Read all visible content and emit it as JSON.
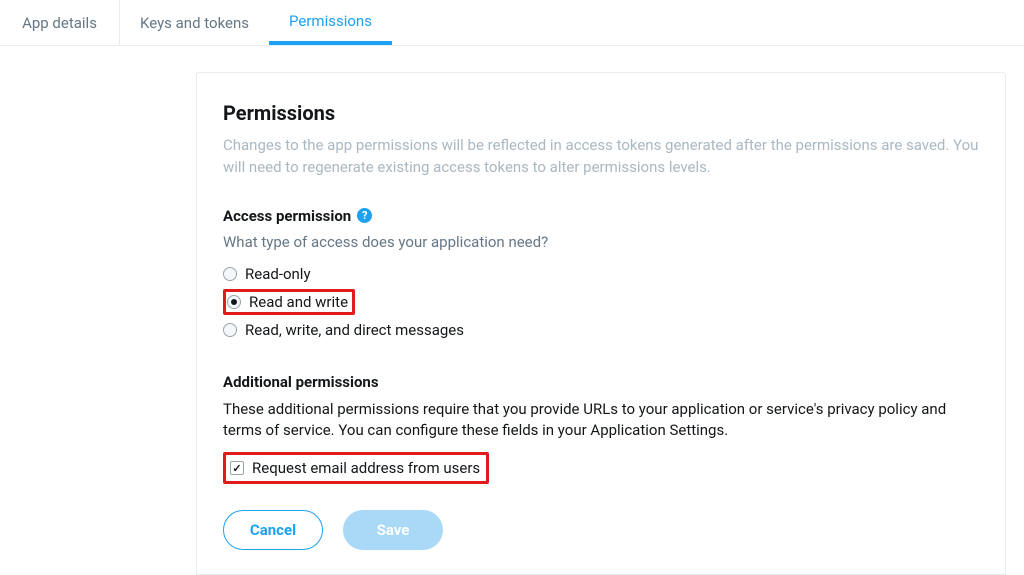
{
  "tabs": [
    {
      "label": "App details",
      "active": false
    },
    {
      "label": "Keys and tokens",
      "active": false
    },
    {
      "label": "Permissions",
      "active": true
    }
  ],
  "panel": {
    "title": "Permissions",
    "description": "Changes to the app permissions will be reflected in access tokens generated after the permissions are saved. You will need to regenerate existing access tokens to alter permissions levels."
  },
  "access": {
    "heading": "Access permission",
    "help_symbol": "?",
    "question": "What type of access does your application need?",
    "options": [
      {
        "label": "Read-only",
        "checked": false,
        "highlight": false
      },
      {
        "label": "Read and write",
        "checked": true,
        "highlight": true
      },
      {
        "label": "Read, write, and direct messages",
        "checked": false,
        "highlight": false
      }
    ]
  },
  "additional": {
    "heading": "Additional permissions",
    "description": "These additional permissions require that you provide URLs to your application or service's privacy policy and terms of service. You can configure these fields in your Application Settings.",
    "checkbox_label": "Request email address from users",
    "checkbox_checked": true
  },
  "actions": {
    "cancel": "Cancel",
    "save": "Save"
  }
}
